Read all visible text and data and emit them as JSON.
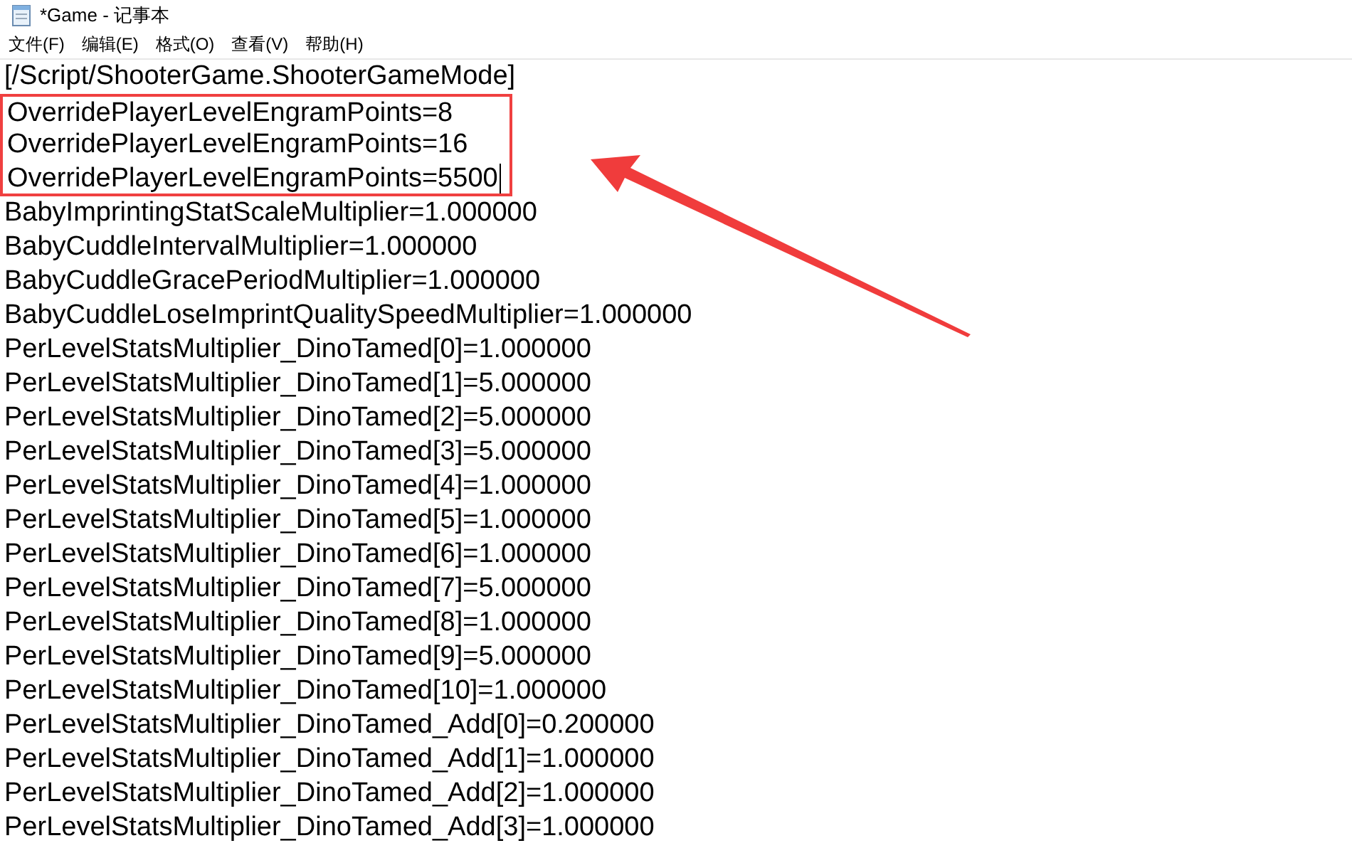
{
  "window": {
    "title": "*Game - 记事本"
  },
  "menu": [
    "文件(F)",
    "编辑(E)",
    "格式(O)",
    "查看(V)",
    "帮助(H)"
  ],
  "lines": [
    {
      "text": "[/Script/ShooterGame.ShooterGameMode]",
      "highlighted": false,
      "caret": false
    },
    {
      "text": "OverridePlayerLevelEngramPoints=8",
      "highlighted": true,
      "caret": false
    },
    {
      "text": "OverridePlayerLevelEngramPoints=16",
      "highlighted": true,
      "caret": false
    },
    {
      "text": "OverridePlayerLevelEngramPoints=5500",
      "highlighted": true,
      "caret": true
    },
    {
      "text": "BabyImprintingStatScaleMultiplier=1.000000",
      "highlighted": false,
      "caret": false
    },
    {
      "text": "BabyCuddleIntervalMultiplier=1.000000",
      "highlighted": false,
      "caret": false
    },
    {
      "text": "BabyCuddleGracePeriodMultiplier=1.000000",
      "highlighted": false,
      "caret": false
    },
    {
      "text": "BabyCuddleLoseImprintQualitySpeedMultiplier=1.000000",
      "highlighted": false,
      "caret": false
    },
    {
      "text": "PerLevelStatsMultiplier_DinoTamed[0]=1.000000",
      "highlighted": false,
      "caret": false
    },
    {
      "text": "PerLevelStatsMultiplier_DinoTamed[1]=5.000000",
      "highlighted": false,
      "caret": false
    },
    {
      "text": "PerLevelStatsMultiplier_DinoTamed[2]=5.000000",
      "highlighted": false,
      "caret": false
    },
    {
      "text": "PerLevelStatsMultiplier_DinoTamed[3]=5.000000",
      "highlighted": false,
      "caret": false
    },
    {
      "text": "PerLevelStatsMultiplier_DinoTamed[4]=1.000000",
      "highlighted": false,
      "caret": false
    },
    {
      "text": "PerLevelStatsMultiplier_DinoTamed[5]=1.000000",
      "highlighted": false,
      "caret": false
    },
    {
      "text": "PerLevelStatsMultiplier_DinoTamed[6]=1.000000",
      "highlighted": false,
      "caret": false
    },
    {
      "text": "PerLevelStatsMultiplier_DinoTamed[7]=5.000000",
      "highlighted": false,
      "caret": false
    },
    {
      "text": "PerLevelStatsMultiplier_DinoTamed[8]=1.000000",
      "highlighted": false,
      "caret": false
    },
    {
      "text": "PerLevelStatsMultiplier_DinoTamed[9]=5.000000",
      "highlighted": false,
      "caret": false
    },
    {
      "text": "PerLevelStatsMultiplier_DinoTamed[10]=1.000000",
      "highlighted": false,
      "caret": false
    },
    {
      "text": "PerLevelStatsMultiplier_DinoTamed_Add[0]=0.200000",
      "highlighted": false,
      "caret": false
    },
    {
      "text": "PerLevelStatsMultiplier_DinoTamed_Add[1]=1.000000",
      "highlighted": false,
      "caret": false
    },
    {
      "text": "PerLevelStatsMultiplier_DinoTamed_Add[2]=1.000000",
      "highlighted": false,
      "caret": false
    },
    {
      "text": "PerLevelStatsMultiplier_DinoTamed_Add[3]=1.000000",
      "highlighted": false,
      "caret": false
    }
  ]
}
